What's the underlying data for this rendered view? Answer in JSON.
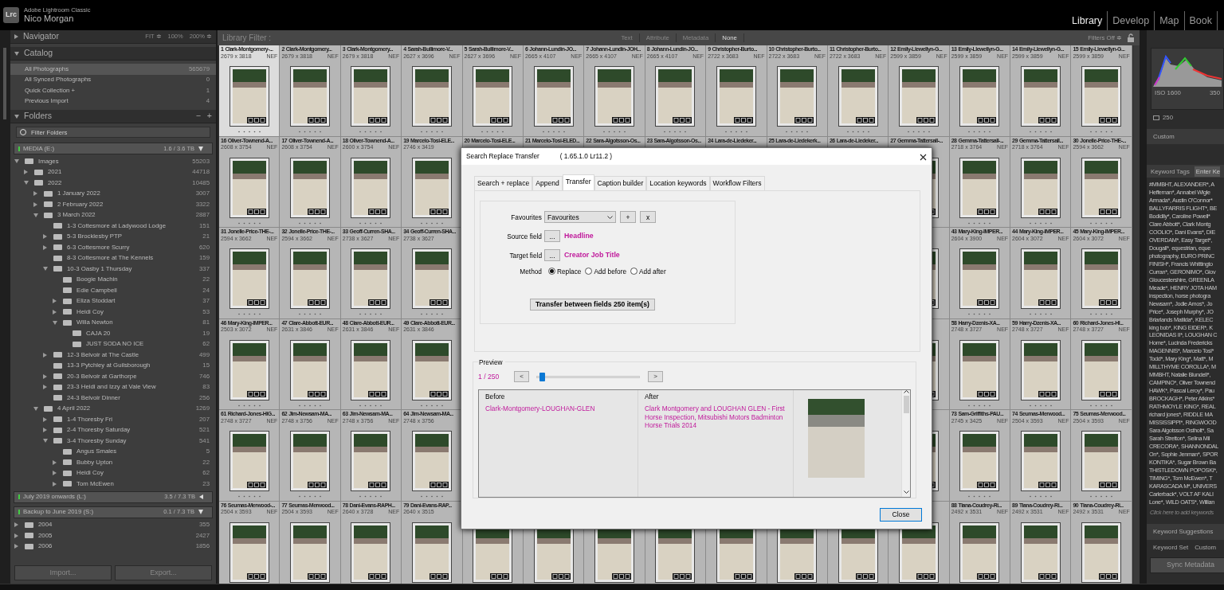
{
  "app": {
    "logo": "Lrc",
    "product": "Adobe Lightroom Classic",
    "user": "Nico Morgan"
  },
  "modules": [
    {
      "label": "Library",
      "selected": true
    },
    {
      "label": "Develop",
      "selected": false
    },
    {
      "label": "Map",
      "selected": false
    },
    {
      "label": "Book",
      "selected": false
    }
  ],
  "left_panel": {
    "navigator": {
      "title": "Navigator",
      "expanded": false,
      "zoom_options": [
        "FIT ≑",
        "100%",
        "200% ≑"
      ]
    },
    "catalog": {
      "title": "Catalog",
      "expanded": true,
      "items": [
        {
          "label": "All Photographs",
          "count": "565679",
          "selected": true
        },
        {
          "label": "All Synced Photographs",
          "count": "0",
          "selected": false
        },
        {
          "label": "Quick Collection +",
          "count": "1",
          "selected": false
        },
        {
          "label": "Previous Import",
          "count": "4",
          "selected": false
        }
      ]
    },
    "folders": {
      "title": "Folders",
      "expanded": true,
      "actions": [
        "−",
        "+"
      ],
      "filter_placeholder": "Filter Folders",
      "volumes": [
        {
          "name": "MEDIA (E:)",
          "usage": "1.6 / 3.6 TB",
          "expanded": true,
          "folders": [
            {
              "name": "Images",
              "count": "55203",
              "expanded": true,
              "children": [
                {
                  "name": "2021",
                  "count": "44718",
                  "expanded": false
                },
                {
                  "name": "2022",
                  "count": "10485",
                  "expanded": true,
                  "children": [
                    {
                      "name": "1 January 2022",
                      "count": "3007",
                      "expanded": false
                    },
                    {
                      "name": "2 February 2022",
                      "count": "3322",
                      "expanded": false
                    },
                    {
                      "name": "3 March 2022",
                      "count": "2887",
                      "expanded": true,
                      "children": [
                        {
                          "name": "1-3 Cottesmore at Ladywood Lodge",
                          "count": "151"
                        },
                        {
                          "name": "5-3 Brocklesby PTP",
                          "count": "21",
                          "expanded": false
                        },
                        {
                          "name": "6-3 Cottesmore Scurry",
                          "count": "620",
                          "expanded": false
                        },
                        {
                          "name": "8-3 Cottesmore at The Kennels",
                          "count": "159"
                        },
                        {
                          "name": "10-3 Oasby 1 Thursday",
                          "count": "337",
                          "expanded": true,
                          "children": [
                            {
                              "name": "Boogie Machin",
                              "count": "22"
                            },
                            {
                              "name": "Edie Campbell",
                              "count": "24"
                            },
                            {
                              "name": "Eliza Stoddart",
                              "count": "37",
                              "expanded": false
                            },
                            {
                              "name": "Heidi Coy",
                              "count": "53",
                              "expanded": false
                            },
                            {
                              "name": "Willa Newton",
                              "count": "81",
                              "expanded": true,
                              "children": [
                                {
                                  "name": "CAJA 20",
                                  "count": "19"
                                },
                                {
                                  "name": "JUST SODA NO ICE",
                                  "count": "62"
                                }
                              ]
                            }
                          ]
                        },
                        {
                          "name": "12-3 Belvoir at The Castle",
                          "count": "499",
                          "expanded": false
                        },
                        {
                          "name": "13-3 Pytchley at Guilsborough",
                          "count": "15"
                        },
                        {
                          "name": "20-3 Belvoir at Garthorpe",
                          "count": "746",
                          "expanded": false
                        },
                        {
                          "name": "23-3 Heidi and Izzy at Vale View",
                          "count": "83",
                          "expanded": false
                        },
                        {
                          "name": "24-3 Belvoir Dinner",
                          "count": "256"
                        }
                      ]
                    },
                    {
                      "name": "4 April 2022",
                      "count": "1269",
                      "expanded": true,
                      "children": [
                        {
                          "name": "1-4 Thoresby Fri",
                          "count": "207",
                          "expanded": false
                        },
                        {
                          "name": "2-4 Thoresby Saturday",
                          "count": "521",
                          "expanded": false
                        },
                        {
                          "name": "3-4 Thoresby Sunday",
                          "count": "541",
                          "expanded": true,
                          "children": [
                            {
                              "name": "Angus Smales",
                              "count": "5"
                            },
                            {
                              "name": "Bubby Upton",
                              "count": "22",
                              "expanded": false
                            },
                            {
                              "name": "Heidi Coy",
                              "count": "62",
                              "expanded": false
                            },
                            {
                              "name": "Tom McEwen",
                              "count": "23",
                              "expanded": false
                            }
                          ]
                        }
                      ]
                    }
                  ]
                }
              ]
            }
          ]
        },
        {
          "name": "July 2019 onwards (L:)",
          "usage": "3.5 / 7.3 TB",
          "expanded": false
        },
        {
          "name": "Backup to June 2019 (S:)",
          "usage": "0.1 / 7.3 TB",
          "expanded": true,
          "folders": [
            {
              "name": "2004",
              "count": "355",
              "expanded": false
            },
            {
              "name": "2005",
              "count": "2427",
              "expanded": false
            },
            {
              "name": "2006",
              "count": "1856",
              "expanded": false
            }
          ]
        }
      ]
    },
    "buttons": [
      "Import...",
      "Export..."
    ]
  },
  "filter_bar": {
    "title": "Library Filter :",
    "options": [
      {
        "label": "Text",
        "selected": false
      },
      {
        "label": "Attribute",
        "selected": false
      },
      {
        "label": "Metadata",
        "selected": false
      },
      {
        "label": "None",
        "selected": true
      }
    ],
    "status": "Filters Off ≑"
  },
  "grid": {
    "rows": [
      {
        "left": [
          {
            "number": "1",
            "title": "Clark-Montgomery-...",
            "dims": "2679 x 3818",
            "ext": "NEF",
            "selected": true
          },
          {
            "number": "2",
            "title": "Clark-Montgomery...",
            "dims": "2679 x 3818",
            "ext": "NEF",
            "selected": false
          },
          {
            "number": "3",
            "title": "Clark-Montgomery...",
            "dims": "2679 x 3818",
            "ext": "NEF",
            "selected": false
          },
          {
            "number": "4",
            "title": "Sarah-Bullimore-V...",
            "dims": "2627 x 3696",
            "ext": "NEF",
            "selected": false
          },
          {
            "number": "5",
            "title": "Sarah-Bullimore-V...",
            "dims": "2627 x 3696",
            "ext": "NEF",
            "selected": false
          },
          {
            "number": "6",
            "title": "Johann-Lundin-JO...",
            "dims": "2665 x 4107",
            "ext": "NEF",
            "selected": false
          },
          {
            "number": "7",
            "title": "Johann-Lundin-JOH...",
            "dims": "2665 x 4107",
            "ext": "NEF",
            "selected": false
          },
          {
            "number": "8",
            "title": "Johann-Lundin-JO...",
            "dims": "2665 x 4107",
            "ext": "NEF",
            "selected": false
          },
          {
            "number": "9",
            "title": "Christopher-Burto...",
            "dims": "2722 x 3683",
            "ext": "NEF",
            "selected": false
          },
          {
            "number": "10",
            "title": "Christopher-Burto...",
            "dims": "2722 x 3683",
            "ext": "NEF",
            "selected": false
          },
          {
            "number": "11",
            "title": "Christopher-Burto...",
            "dims": "2722 x 3683",
            "ext": "NEF",
            "selected": false
          },
          {
            "number": "12",
            "title": "Emily-Llewellyn-G...",
            "dims": "2599 x 3859",
            "ext": "NEF",
            "selected": false
          },
          {
            "number": "13",
            "title": "Emily-Llewellyn-G...",
            "dims": "2599 x 3859",
            "ext": "NEF",
            "selected": false
          },
          {
            "number": "14",
            "title": "Emily-Llewellyn-G...",
            "dims": "2599 x 3859",
            "ext": "NEF",
            "selected": false
          },
          {
            "number": "15",
            "title": "Emily-Llewellyn-G...",
            "dims": "2599 x 3859",
            "ext": "NEF",
            "selected": false
          }
        ]
      },
      {
        "left": [
          {
            "number": "16",
            "title": "Oliver-Townend-A...",
            "dims": "2608 x 3754",
            "ext": "NEF",
            "selected": false
          },
          {
            "number": "17",
            "title": "Oliver-Townend-A...",
            "dims": "2608 x 3754",
            "ext": "NEF",
            "selected": false
          },
          {
            "number": "18",
            "title": "Oliver-Townend-A...",
            "dims": "2600 x 3754",
            "ext": "NEF",
            "selected": false
          },
          {
            "number": "19",
            "title": "Marcelo-Tosi-ELE...",
            "dims": "2746 x 3419",
            "selected": false
          },
          {
            "number": "20",
            "title": "Marcelo-Tosi-ELE...",
            "selected": false
          },
          {
            "number": "21",
            "title": "Marcelo-Tosi-ELED...",
            "selected": false
          },
          {
            "number": "22",
            "title": "Sara-Algotsson-Os...",
            "selected": false
          },
          {
            "number": "23",
            "title": "Sara-Algotsson-Os...",
            "selected": false
          },
          {
            "number": "24",
            "title": "Lara-de-Liedeker...",
            "selected": false
          },
          {
            "number": "25",
            "title": "Lara-de-Liedekerk...",
            "selected": false
          },
          {
            "number": "26",
            "title": "Lara-de-Liedeker...",
            "selected": false
          },
          {
            "number": "27",
            "title": "Gemma-Tattersall-...",
            "selected": false
          },
          {
            "number": "28",
            "title": "Gemma-Tattersall-...",
            "dims": "2718 x 3764",
            "ext": "NEF",
            "selected": false
          },
          {
            "number": "29",
            "title": "Gemma-Tattersall...",
            "dims": "2718 x 3764",
            "ext": "NEF",
            "selected": false
          },
          {
            "number": "30",
            "title": "Jonelle-Price-THE-...",
            "dims": "2594 x 3662",
            "ext": "NEF",
            "selected": false
          }
        ]
      },
      {
        "left": [
          {
            "number": "31",
            "title": "Jonelle-Price-THE-...",
            "dims": "2594 x 3662",
            "ext": "NEF",
            "selected": false
          },
          {
            "number": "32",
            "title": "Jonelle-Price-THE-...",
            "dims": "2594 x 3662",
            "ext": "NEF",
            "selected": false
          },
          {
            "number": "33",
            "title": "Geoff-Curren-SHA...",
            "dims": "2738 x 3627",
            "ext": "NEF",
            "selected": false
          },
          {
            "number": "34",
            "title": "Geoff-Curren-SHA...",
            "dims": "2738 x 3627",
            "selected": false
          }
        ],
        "right": [
          {
            "number": "43",
            "title": "Mary-King-IMPER...",
            "dims": "2604 x 3900",
            "ext": "NEF",
            "selected": false
          },
          {
            "number": "44",
            "title": "Mary-King-IMPER...",
            "dims": "2604 x 3072",
            "ext": "NEF",
            "selected": false
          },
          {
            "number": "45",
            "title": "Mary-King-IMPER...",
            "dims": "2604 x 3072",
            "ext": "NEF",
            "selected": false
          }
        ]
      },
      {
        "left": [
          {
            "number": "46",
            "title": "Mary-King-IMPER...",
            "dims": "2503 x 3072",
            "ext": "NEF",
            "selected": false
          },
          {
            "number": "47",
            "title": "Clare-Abbott-EUR...",
            "dims": "2631 x 3846",
            "ext": "NEF",
            "selected": false
          },
          {
            "number": "48",
            "title": "Clare-Abbott-EUR...",
            "dims": "2631 x 3846",
            "ext": "NEF",
            "selected": false
          },
          {
            "number": "49",
            "title": "Clare-Abbott-EUR...",
            "dims": "2631 x 3846",
            "selected": false
          }
        ],
        "right": [
          {
            "number": "58",
            "title": "Harry-Dzenis-XA...",
            "dims": "2748 x 3727",
            "ext": "NEF",
            "selected": false
          },
          {
            "number": "59",
            "title": "Harry-Dzenis-XA...",
            "dims": "2748 x 3727",
            "ext": "NEF",
            "selected": false
          },
          {
            "number": "60",
            "title": "Richard-Jones-HI...",
            "dims": "2748 x 3727",
            "ext": "NEF",
            "selected": false
          }
        ]
      },
      {
        "left": [
          {
            "number": "61",
            "title": "Richard-Jones-HIG...",
            "dims": "2748 x 3727",
            "ext": "NEF",
            "selected": false
          },
          {
            "number": "62",
            "title": "Jim-Newsam-MA...",
            "dims": "2748 x 3756",
            "ext": "NEF",
            "selected": false
          },
          {
            "number": "63",
            "title": "Jim-Newsam-MA...",
            "dims": "2748 x 3756",
            "ext": "NEF",
            "selected": false
          },
          {
            "number": "64",
            "title": "Jim-Newsam-MA...",
            "dims": "2748 x 3756",
            "selected": false
          }
        ],
        "right": [
          {
            "number": "73",
            "title": "Sam-Griffiths-PAU...",
            "dims": "2745 x 3425",
            "ext": "NEF",
            "selected": false
          },
          {
            "number": "74",
            "title": "Seumas-Merwood...",
            "dims": "2504 x 3593",
            "ext": "NEF",
            "selected": false
          },
          {
            "number": "75",
            "title": "Seumas-Merwood...",
            "dims": "2504 x 3593",
            "ext": "NEF",
            "selected": false
          }
        ]
      },
      {
        "left": [
          {
            "number": "76",
            "title": "Seumas-Merwood-...",
            "dims": "2504 x 3593",
            "ext": "NEF",
            "selected": false
          },
          {
            "number": "77",
            "title": "Seumas-Merwood...",
            "dims": "2504 x 3593",
            "ext": "NEF",
            "selected": false
          },
          {
            "number": "78",
            "title": "Dani-Evans-RAPH...",
            "dims": "2640 x 3728",
            "ext": "NEF",
            "selected": false
          },
          {
            "number": "79",
            "title": "Dani-Evans-RAP...",
            "dims": "2640 x 3515",
            "selected": false
          }
        ],
        "right": [
          {
            "number": "88",
            "title": "Tiana-Coudrey-Ri...",
            "dims": "2492 x 3531",
            "ext": "NEF",
            "selected": false
          },
          {
            "number": "89",
            "title": "Tiana-Coudrey-Ri...",
            "dims": "2492 x 3531",
            "ext": "NEF",
            "selected": false
          },
          {
            "number": "90",
            "title": "Tiana-Coudrey-Ri...",
            "dims": "2492 x 3531",
            "ext": "NEF",
            "selected": false
          }
        ]
      }
    ]
  },
  "right_panel": {
    "iso": "ISO 1600",
    "focal": "350",
    "count": "250",
    "preset": "Custom",
    "keyword_tags": {
      "title": "Keyword Tags",
      "field": "Enter Ke",
      "lines": [
        "#MMBHT, ALEXANDER*, A",
        "Heffernan*, Annabel Wigle",
        "Armada*, Austin O'Connor*",
        "BALLYFARRIS FLIGHT*, BE",
        "Bodidily*, Caroline Powell*",
        "Clare Abbott*, Clark Montg",
        "COOLIO*, Dani Evans*, DIE",
        "OVERDAM*, Easy Target*,",
        "Dougall*, equestrian, eque",
        "photography, EURO PRINC",
        "FINISH*, Francis Whittingto",
        "Curran*, GERONIMO*, Giov",
        "Gloucestershire, GREENLA",
        "Meade*, HENRY JOTA HAM",
        "inspection, horse photogra",
        "Newsam*, Jodie Amos*, Jo",
        "Price*, Joseph Murphy*, JO",
        "Briarlands Matilda*, KELEC",
        "king bob*, KING EIDER*, K",
        "LEONIDAS II*, LOUGHAN C",
        "Home*, Lucinda Fredericks",
        "MAGENNIS*, Marcelo Tosi*",
        "Todd*, Mary King*, Matt*, M",
        "MILLTHYME COROLLA*, M",
        "MMBHT, Natalie Blundell*,",
        "CAMPINO*, Oliver Townend",
        "HAWK*, Pascal Leroy*, Pau",
        "BROCKAGH*, Peter Atkins*",
        "RATHMOYLE KING*, REAL",
        "richard jones*, RIDDLE MA",
        "MISSISSIPPI*, RINGWOOD",
        "Sara Algotsson Ostholt*, Sa",
        "Sarah Stretton*, Selina Mil",
        "CRECORA*, SHANNONDAL",
        "On*, Sophie Jenman*, SPOR",
        "KONTIKA*, Sugar Brown Ba",
        "THISTLEDOWN POPOSKI*,",
        "TIMING*, Tom McEwen*, T",
        "KARASCADA M*, UNIVERS",
        "Carlerback*, VOLT AF KALI",
        "Lone*, WILD OATS*, Willian"
      ],
      "hint": "Click here to add keywords"
    },
    "suggestions_title": "Keyword Suggestions",
    "keyword_set": {
      "label": "Keyword Set",
      "value": "Custom"
    },
    "sync_button": "Sync Metadata"
  },
  "dialog": {
    "title": "Search Replace Transfer",
    "version": "( 1.65.1.0 Lr11.2 )",
    "tabs": [
      {
        "label": "Search + replace",
        "selected": false
      },
      {
        "label": "Append",
        "selected": false
      },
      {
        "label": "Transfer",
        "selected": true
      },
      {
        "label": "Caption builder",
        "selected": false
      },
      {
        "label": "Location keywords",
        "selected": false
      },
      {
        "label": "Workflow Filters",
        "selected": false
      }
    ],
    "favourites": {
      "label": "Favourites",
      "value": "Favourites",
      "buttons": [
        "+",
        "x"
      ]
    },
    "source": {
      "label": "Source field",
      "button": "...",
      "value": "Headline"
    },
    "target": {
      "label": "Target field",
      "button": "...",
      "value": "Creator Job Title"
    },
    "method": {
      "label": "Method",
      "options": [
        {
          "label": "Replace",
          "selected": true
        },
        {
          "label": "Add before",
          "selected": false
        },
        {
          "label": "Add after",
          "selected": false
        }
      ]
    },
    "action_button": "Transfer between fields 250  item(s)",
    "preview": {
      "title": "Preview",
      "counter": "1 / 250",
      "prev": "<",
      "next": ">",
      "level": 0.02,
      "before": {
        "header": "Before",
        "text": "Clark-Montgomery-LOUGHAN-GLEN"
      },
      "after": {
        "header": "After",
        "text": "Clark Montgomery and LOUGHAN GLEN - First Horse Inspection, Mitsubishi Motors Badminton Horse Trials 2014"
      }
    },
    "close_button": "Close"
  }
}
